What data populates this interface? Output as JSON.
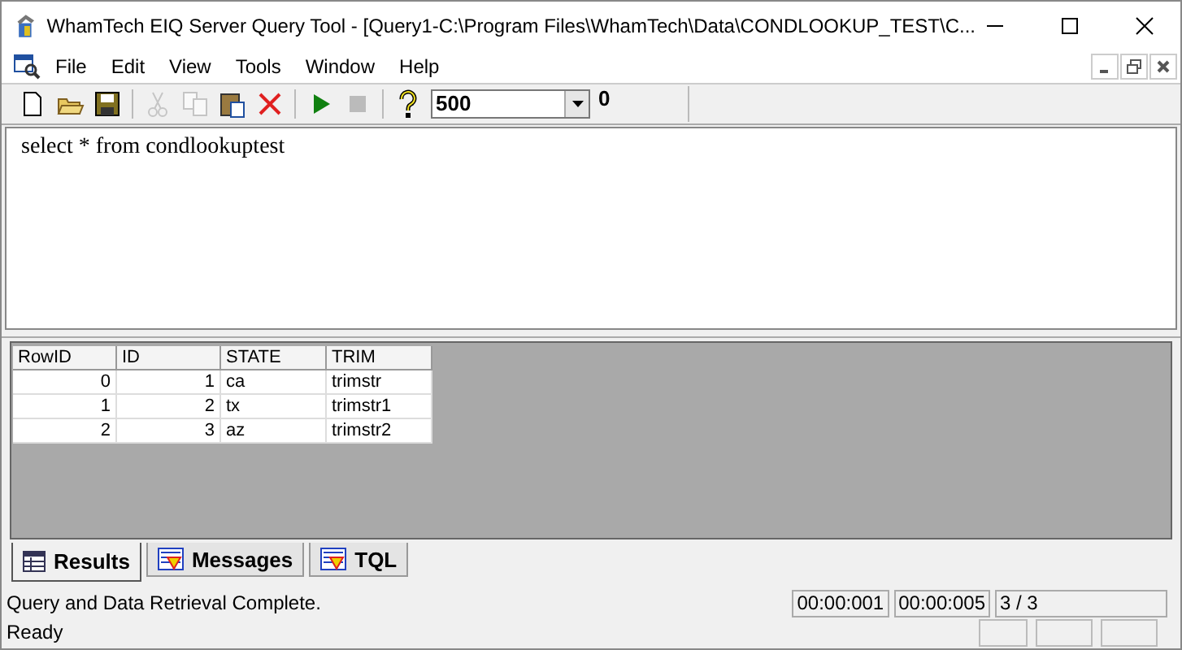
{
  "window": {
    "title": "WhamTech EIQ Server Query Tool - [Query1-C:\\Program Files\\WhamTech\\Data\\CONDLOOKUP_TEST\\C..."
  },
  "menu": [
    "File",
    "Edit",
    "View",
    "Tools",
    "Window",
    "Help"
  ],
  "toolbar": [
    {
      "kind": "new",
      "disabled": false
    },
    {
      "kind": "open",
      "disabled": false
    },
    {
      "kind": "save",
      "disabled": false
    },
    {
      "kind": "sep"
    },
    {
      "kind": "cut",
      "disabled": true
    },
    {
      "kind": "copy",
      "disabled": true
    },
    {
      "kind": "paste",
      "disabled": false
    },
    {
      "kind": "delete",
      "disabled": false
    },
    {
      "kind": "sep"
    },
    {
      "kind": "run",
      "disabled": false
    },
    {
      "kind": "stop",
      "disabled": true
    },
    {
      "kind": "sep"
    },
    {
      "kind": "help",
      "disabled": false
    }
  ],
  "row_limit": {
    "value": "500"
  },
  "row_count": "0",
  "editor": {
    "value": "select * from condlookuptest"
  },
  "table": {
    "columns": [
      "RowID",
      "ID",
      "STATE",
      "TRIM"
    ],
    "rows": [
      [
        "0",
        "1",
        "ca",
        "trimstr"
      ],
      [
        "1",
        "2",
        "tx",
        "trimstr1"
      ],
      [
        "2",
        "3",
        "az",
        "trimstr2"
      ]
    ]
  },
  "tabs": [
    {
      "label": "Results",
      "selected": true
    },
    {
      "label": "Messages",
      "selected": false
    },
    {
      "label": "TQL",
      "selected": false
    }
  ],
  "status_bar": {
    "message": "Query and Data Retrieval Complete.",
    "times": [
      "00:00:001",
      "00:00:005"
    ],
    "rows": "3 / 3",
    "state": "Ready"
  }
}
